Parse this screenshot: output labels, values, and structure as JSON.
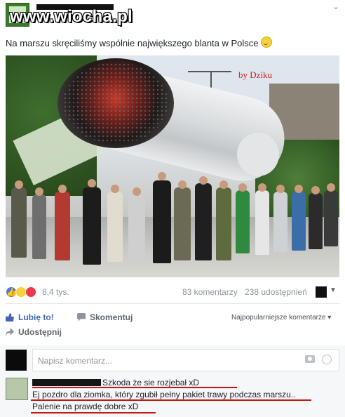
{
  "header": {
    "watermark": "www.wiocha.pl",
    "chevron": "⌄"
  },
  "post": {
    "text": "Na marszu skręciliśmy wspólnie największego blanta w Polsce",
    "photo_caption": "by Dziku"
  },
  "stats": {
    "reactions": "8,4 tys.",
    "comments": "83 komentarzy",
    "shares": "238 udostępnień"
  },
  "actions": {
    "like": "Lubię to!",
    "comment": "Skomentuj",
    "share": "Udostępnij",
    "sort": "Najpopularniejsze komentarze ▾"
  },
  "comment_box": {
    "placeholder": "Napisz komentarz..."
  },
  "reply": {
    "line1": "Szkoda że sie rozjebał xD",
    "line2": "Ej pozdro dla ziomka, który zgubił pełny pakiet trawy podczas marszu..",
    "line3": "Palenie na prawdę dobre xD"
  },
  "colors": {
    "accent": "#4267b2",
    "annotation": "#d21f1f"
  }
}
